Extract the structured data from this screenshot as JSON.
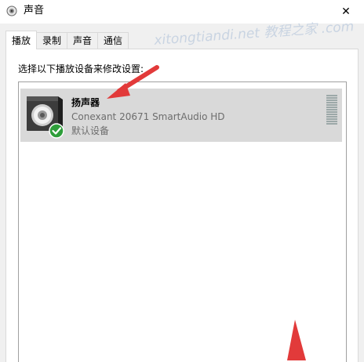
{
  "window": {
    "title": "声音",
    "close_label": "✕",
    "watermark": "xitongtiandi.net 教程之家 .com"
  },
  "tabs": [
    {
      "label": "播放",
      "active": true
    },
    {
      "label": "录制",
      "active": false
    },
    {
      "label": "声音",
      "active": false
    },
    {
      "label": "通信",
      "active": false
    }
  ],
  "playback": {
    "instruction": "选择以下播放设备来修改设置:",
    "devices": [
      {
        "name": "扬声器",
        "description": "Conexant 20671 SmartAudio HD",
        "status": "默认设备",
        "default": true,
        "level_meter_bars": 13
      }
    ]
  },
  "colors": {
    "selection": "#d9d9d9",
    "check": "#2e9e3a",
    "annotation_arrow": "#e23a3a"
  }
}
